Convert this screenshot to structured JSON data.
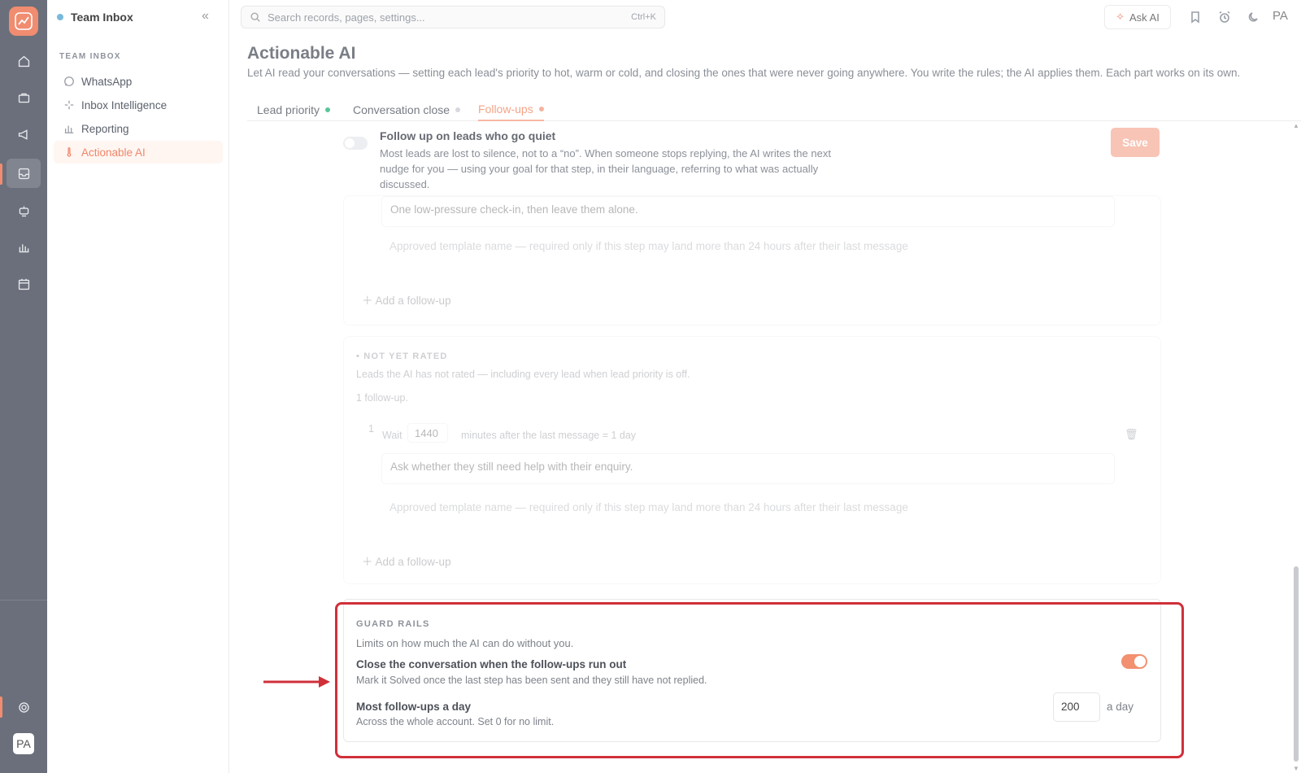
{
  "rail": {
    "items": [
      "home-icon",
      "briefcase-icon",
      "megaphone-icon",
      "inbox-icon",
      "bot-icon",
      "chart-icon",
      "calendar-icon"
    ],
    "active": "inbox-icon",
    "avatar": "PA"
  },
  "sidebar": {
    "workspace": "Team Inbox",
    "section": "TEAM INBOX",
    "items": [
      {
        "label": "WhatsApp",
        "icon": "whatsapp-icon"
      },
      {
        "label": "Inbox Intelligence",
        "icon": "sparkle-icon"
      },
      {
        "label": "Reporting",
        "icon": "bar-chart-icon"
      },
      {
        "label": "Actionable AI",
        "icon": "thermometer-icon"
      }
    ]
  },
  "topbar": {
    "search_placeholder": "Search records, pages, settings...",
    "shortcut": "Ctrl+K",
    "ask_ai": "Ask AI",
    "user_initials": "PA"
  },
  "page": {
    "title": "Actionable AI",
    "subtitle": "Let AI read your conversations — setting each lead's priority to hot, warm or cold, and closing the ones that were never going anywhere. You write the rules; the AI applies them. Each part works on its own.",
    "tabs": [
      {
        "label": "Lead priority",
        "dot_color": "#5bc49a"
      },
      {
        "label": "Conversation close",
        "dot_color": "#d6d8dc"
      },
      {
        "label": "Follow-ups",
        "dot_color": "#f4b3a0"
      }
    ],
    "active_tab": "Follow-ups"
  },
  "followups": {
    "title": "Follow up on leads who go quiet",
    "description": "Most leads are lost to silence, not to a “no”. When someone stops replying, the AI writes the next nudge for you — using your goal for that step, in their language, referring to what was actually discussed.",
    "save_label": "Save",
    "enabled": false
  },
  "card1": {
    "step_text": "One low-pressure check-in, then leave them alone.",
    "template_placeholder": "Approved template name — required only if this step may land more than 24 hours after their last message",
    "add_label": "Add a follow-up"
  },
  "card2": {
    "heading": "• NOT YET RATED",
    "description": "Leads the AI has not rated — including every lead when lead priority is off.",
    "count": "1 follow-up.",
    "step_number": "1",
    "wait_label": "Wait",
    "wait_value": "1440",
    "wait_suffix": "minutes after the last message = 1 day",
    "step_text": "Ask whether they still need help with their enquiry.",
    "template_placeholder": "Approved template name — required only if this step may land more than 24 hours after their last message",
    "add_label": "Add a follow-up"
  },
  "guard_rails": {
    "heading": "GUARD RAILS",
    "subheading": "Limits on how much the AI can do without you.",
    "close_title": "Close the conversation when the follow-ups run out",
    "close_desc": "Mark it Solved once the last step has been sent and they still have not replied.",
    "close_enabled": true,
    "limit_title": "Most follow-ups a day",
    "limit_desc": "Across the whole account. Set 0 for no limit.",
    "limit_value": "200",
    "limit_suffix": "a day"
  },
  "colors": {
    "accent": "#f0866a",
    "annotation": "#d0303a"
  }
}
